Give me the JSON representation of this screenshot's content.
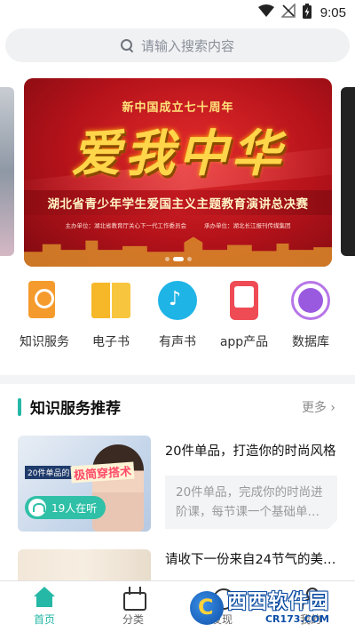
{
  "status_bar": {
    "time": "9:05",
    "icons": [
      "wifi-icon",
      "no-signal-icon",
      "battery-charging-icon"
    ]
  },
  "search": {
    "placeholder": "请输入搜索内容",
    "icon": "search-icon"
  },
  "banner": {
    "line1": "新中国成立七十周年",
    "headline": "爱我中华",
    "line2": "湖北省青少年学生爱国主义主题教育演讲总决赛",
    "host": "主办单位：湖北省教育厅关心下一代工作委员会",
    "organizer": "承办单位：湖北长江报刊传媒集团",
    "accent": "#c41a21"
  },
  "categories": [
    {
      "label": "知识服务",
      "icon": "knowledge-service-icon"
    },
    {
      "label": "电子书",
      "icon": "ebook-icon"
    },
    {
      "label": "有声书",
      "icon": "audiobook-icon"
    },
    {
      "label": "app产品",
      "icon": "app-product-icon"
    },
    {
      "label": "数据库",
      "icon": "database-icon"
    }
  ],
  "recommend": {
    "title": "知识服务推荐",
    "more": "更多",
    "accent": "#25b8a6",
    "items": [
      {
        "title": "20件单品，打造你的时尚风格",
        "desc": "20件单品，完成你的时尚进阶课，每节课一个基础单…",
        "thumb_tag1": "20件单品的",
        "thumb_tag2": "极简穿搭术",
        "listeners": "19人在听"
      },
      {
        "title": "请收下一份来自24节气的美…"
      }
    ]
  },
  "bottom_nav": {
    "items": [
      {
        "label": "首页",
        "icon": "home-icon",
        "active": true
      },
      {
        "label": "分类",
        "icon": "category-icon",
        "active": false
      },
      {
        "label": "发现",
        "icon": "discover-icon",
        "active": false
      },
      {
        "label": "我的",
        "icon": "profile-icon",
        "active": false
      }
    ]
  },
  "watermark": {
    "brand": "西西软件园",
    "domain": "CR173.COM"
  }
}
